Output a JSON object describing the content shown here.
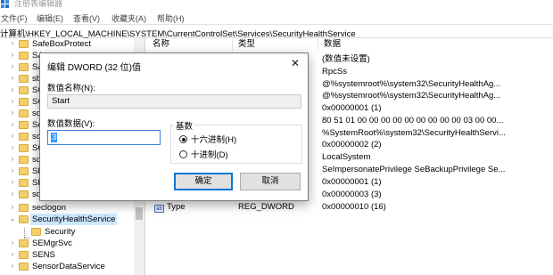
{
  "window": {
    "title": "注册表编辑器"
  },
  "menu": [
    {
      "label": "文件(F)"
    },
    {
      "label": "编辑(E)"
    },
    {
      "label": "查看(V)"
    },
    {
      "label": "收藏夹(A)"
    },
    {
      "label": "帮助(H)"
    }
  ],
  "address": {
    "path": "计算机\\HKEY_LOCAL_MACHINE\\SYSTEM\\CurrentControlSet\\Services\\SecurityHealthService"
  },
  "tree": {
    "items": [
      {
        "label": "SafeBoxProtect"
      },
      {
        "label": "SA"
      },
      {
        "label": "SA"
      },
      {
        "label": "sb"
      },
      {
        "label": "SC"
      },
      {
        "label": "SC"
      },
      {
        "label": "sc"
      },
      {
        "label": "Sc"
      },
      {
        "label": "sc"
      },
      {
        "label": "SC"
      },
      {
        "label": "sc"
      },
      {
        "label": "SD"
      },
      {
        "label": "SD"
      },
      {
        "label": "sd"
      },
      {
        "label": "seclogon"
      },
      {
        "label": "SecurityHealthService"
      },
      {
        "label": "Security"
      },
      {
        "label": "SEMgrSvc"
      },
      {
        "label": "SENS"
      },
      {
        "label": "SensorDataService"
      }
    ]
  },
  "list": {
    "columns": {
      "name": "名称",
      "type": "类型",
      "data": "数据"
    },
    "visible_data": [
      "(数值未设置)",
      "RpcSs",
      "@%systemroot%\\system32\\SecurityHealthAg...",
      "@%systemroot%\\system32\\SecurityHealthAg...",
      "0x00000001 (1)",
      "80 51 01 00 00 00 00 00 00 00 00 00 03 00 00...",
      "%SystemRoot%\\system32\\SecurityHealthServi...",
      "0x00000002 (2)",
      "LocalSystem",
      "SeImpersonatePrivilege SeBackupPrivilege Se...",
      "0x00000001 (1)",
      "0x00000003 (3)"
    ],
    "last_row": {
      "name": "Type",
      "type": "REG_DWORD",
      "data": "0x00000010 (16)",
      "icon": "ab"
    }
  },
  "dialog": {
    "title": "编辑 DWORD (32 位)值",
    "close_glyph": "✕",
    "value_name_label": "数值名称(N):",
    "value_name": "Start",
    "value_data_label": "数值数据(V):",
    "value_data": "3",
    "base_label": "基数",
    "hex_label": "十六进制(H)",
    "dec_label": "十进制(D)",
    "ok_label": "确定",
    "cancel_label": "取消",
    "selected_base": "hex"
  },
  "colors": {
    "accent": "#0078d7",
    "selection": "#cce8ff",
    "folder": "#f3cf6b"
  }
}
